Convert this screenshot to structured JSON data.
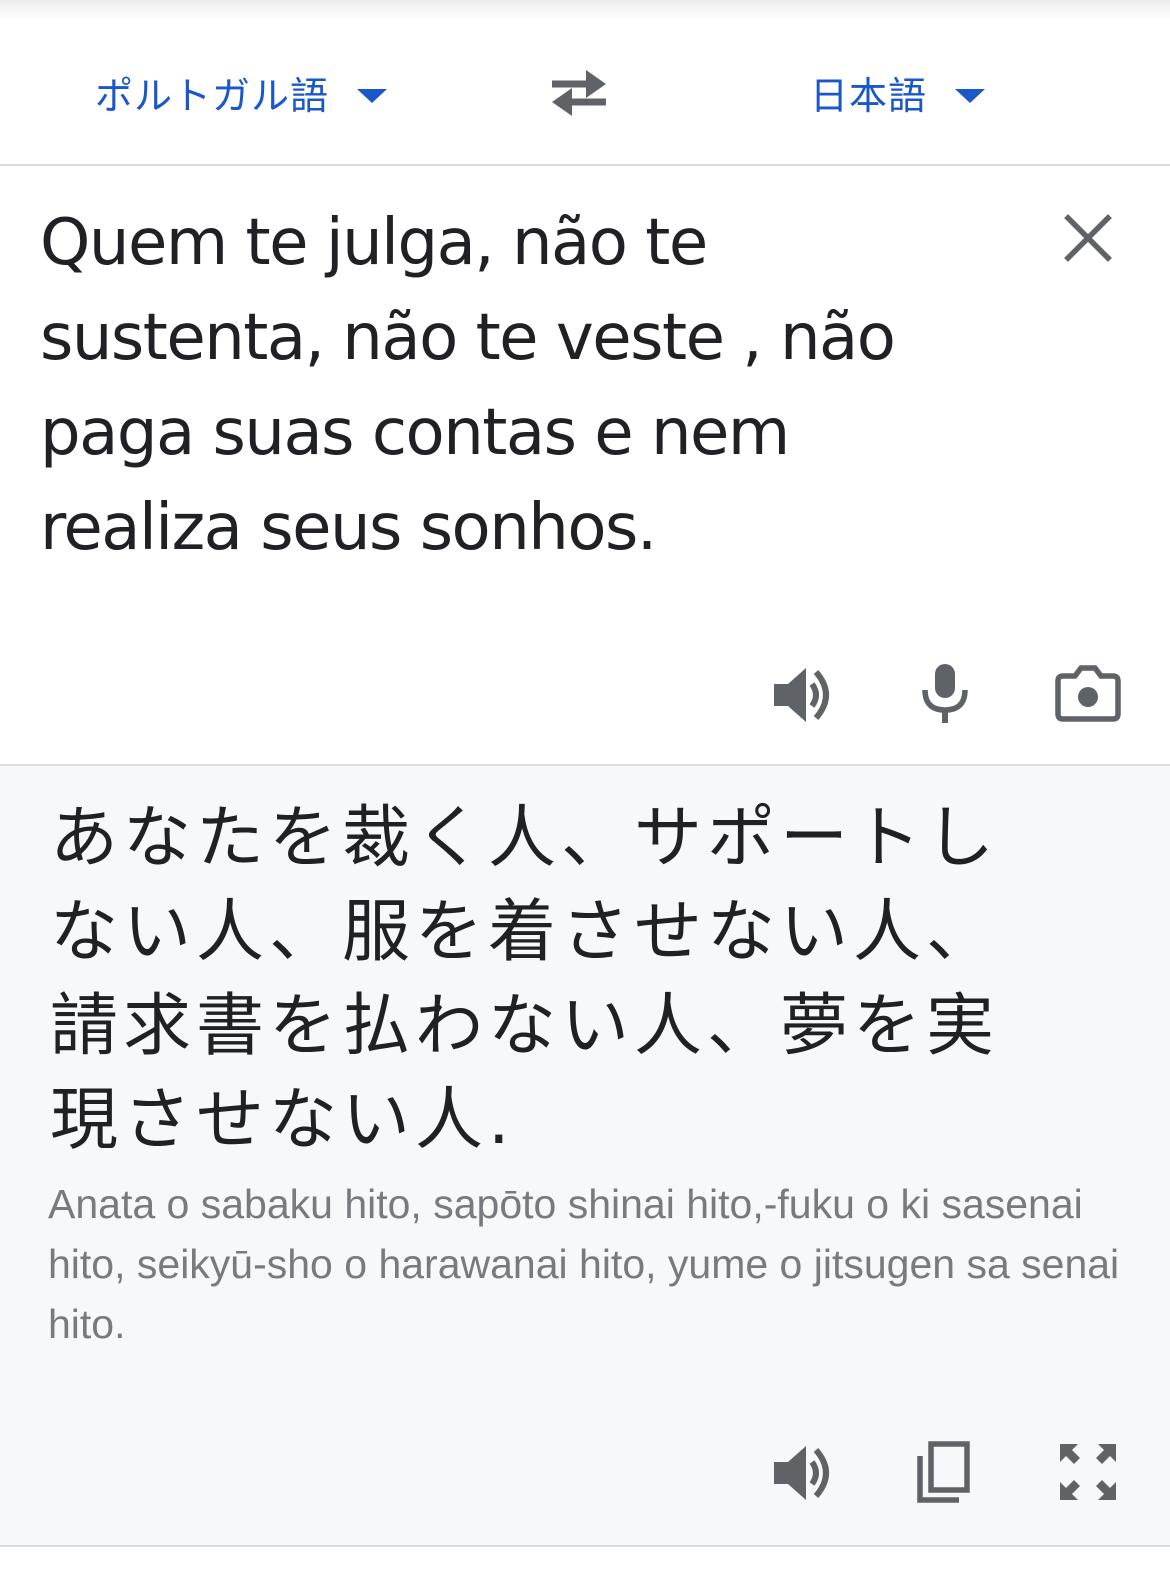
{
  "language_bar": {
    "source_language": "ポルトガル語",
    "target_language": "日本語",
    "swap_icon": "swap-arrows-icon",
    "dropdown_icon": "caret-down-icon"
  },
  "source": {
    "text": "Quem te julga, não te sustenta, não te veste , não paga suas contas e nem realiza seus sonhos.",
    "icons": [
      "close-icon",
      "speaker-icon",
      "microphone-icon",
      "camera-icon"
    ]
  },
  "result": {
    "text": "あなたを裁く人、サポートしない人、服を着させない人、請求書を払わない人、夢を実現させない人.",
    "romanization": "Anata o sabaku hito, sapōto shinai hito,-fuku o ki sasenai hito, seikyū-sho o harawanai hito, yume o jitsugen sa senai hito.",
    "icons": [
      "speaker-icon",
      "copy-icon",
      "fullscreen-icon"
    ]
  },
  "colors": {
    "accent": "#1a57c9",
    "icon": "#5f6368",
    "result_background": "#f7f8fa",
    "divider": "#dadce0"
  }
}
